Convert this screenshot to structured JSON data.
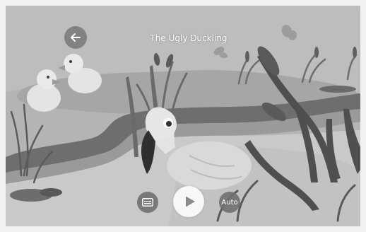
{
  "header": {
    "title": "The Ugly Duckling",
    "back_icon": "arrow-left-icon"
  },
  "controls": {
    "subtitles_icon": "subtitles-icon",
    "play_icon": "play-icon",
    "auto_label": "Auto"
  },
  "colors": {
    "play_button_bg": "#f7f7f7",
    "play_icon": "#8a8a8a",
    "control_bg": "#707070",
    "title_text": "#ffffff"
  }
}
